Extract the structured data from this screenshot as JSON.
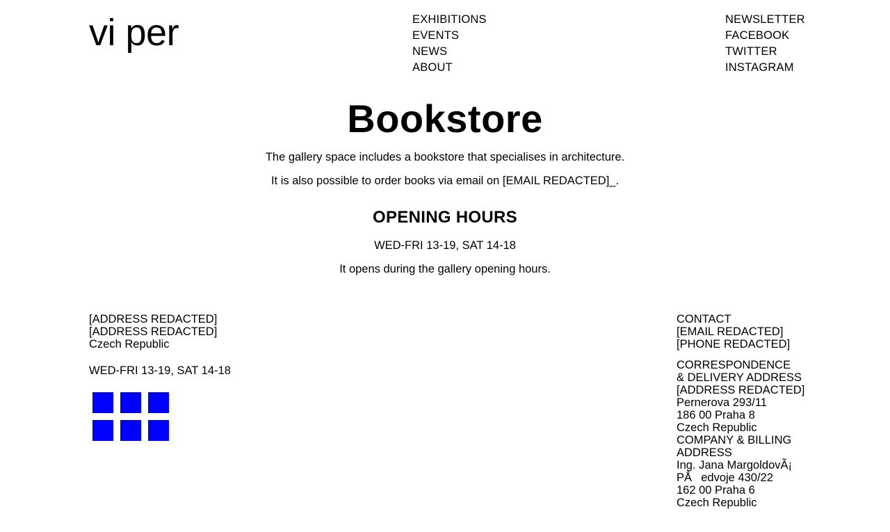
{
  "header": {
    "logo": "vi per",
    "nav": [
      "EXHIBITIONS",
      "EVENTS",
      "NEWS",
      "ABOUT"
    ],
    "social_nav": [
      "NEWSLETTER",
      "FACEBOOK",
      "TWITTER",
      "INSTAGRAM"
    ]
  },
  "main": {
    "title": "Bookstore",
    "intro_1": "The gallery space includes a bookstore that specialises in architecture.",
    "intro_2": "It is also possible to order books via email on [EMAIL REDACTED]_.",
    "hours_heading": "OPENING HOURS",
    "hours_1": "WED-FRI 13-19, SAT 14-18",
    "hours_2": "It opens during the gallery opening hours."
  },
  "footer": {
    "address": [
      "[ADDRESS REDACTED]",
      "[ADDRESS REDACTED]",
      "Czech Republic"
    ],
    "hours": "WED-FRI 13-19, SAT 14-18",
    "social_icons": [
      "social-icon",
      "social-icon",
      "social-icon",
      "social-icon",
      "social-icon",
      "social-icon"
    ],
    "icon_color": "#0000ff",
    "contact": [
      "CONTACT",
      "[EMAIL REDACTED]",
      "[PHONE REDACTED]"
    ],
    "correspondence": [
      "CORRESPONDENCE",
      "& DELIVERY ADDRESS",
      "[ADDRESS REDACTED]",
      "Pernerova 293/11",
      "186 00 Praha 8",
      "Czech Republic",
      "COMPANY & BILLING",
      "ADDRESS",
      "Ing. Jana MargoldovÃ¡",
      "PÅedvoje 430/22",
      "162 00 Praha 6",
      "Czech Republic"
    ]
  }
}
